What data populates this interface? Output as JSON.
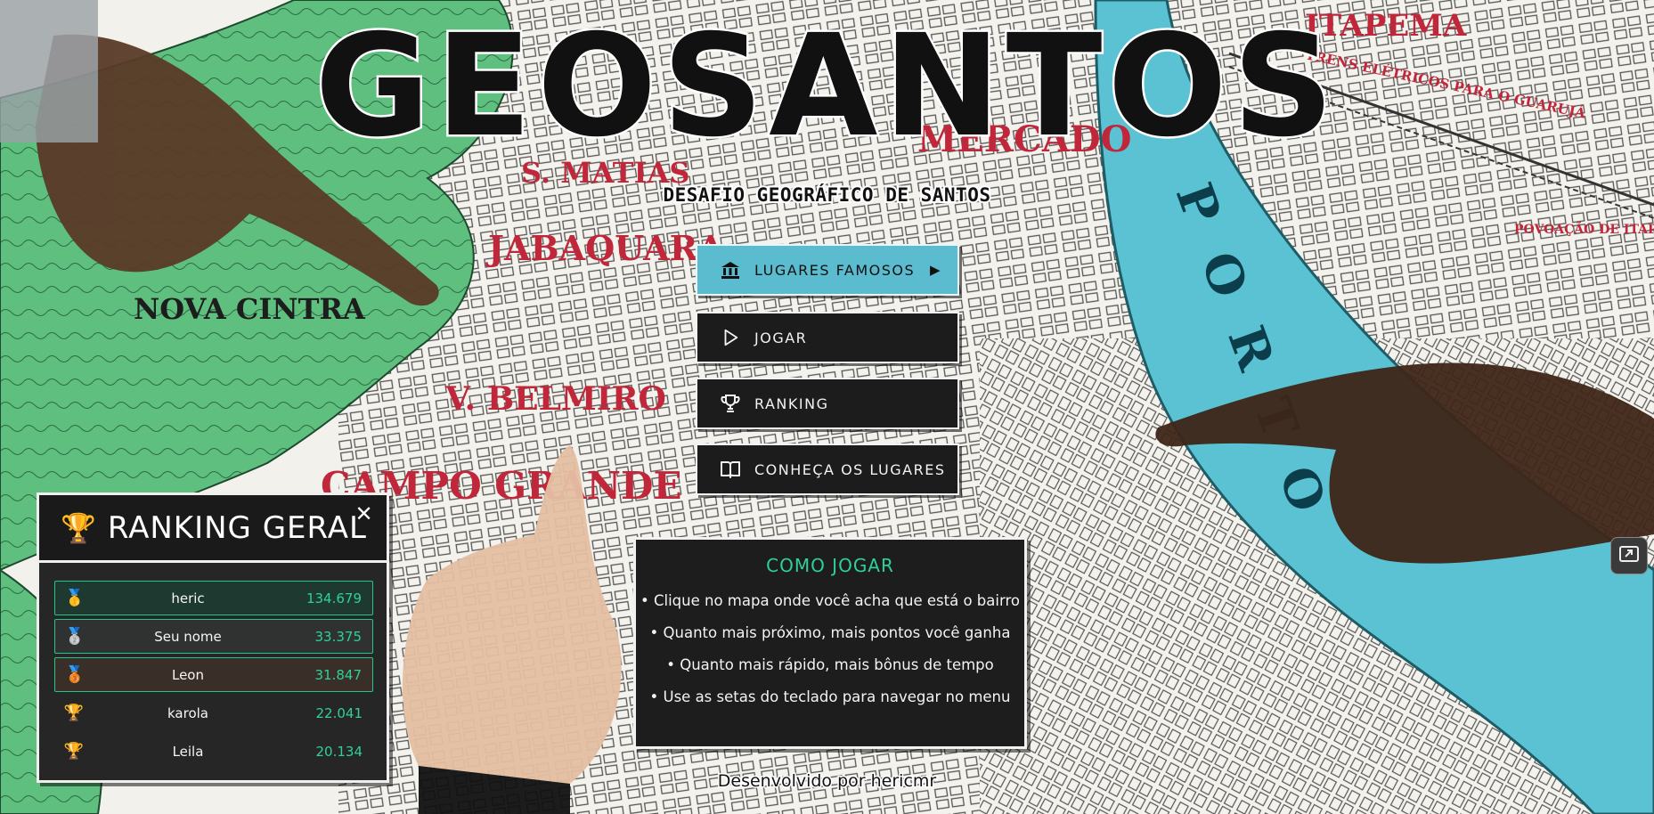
{
  "title": "GEOSANTOS",
  "subtitle": "DESAFIO GEOGRÁFICO DE SANTOS",
  "menu": {
    "items": [
      {
        "label": "LUGARES FAMOSOS",
        "icon": "bank-icon",
        "active": true
      },
      {
        "label": "JOGAR",
        "icon": "play-icon",
        "active": false
      },
      {
        "label": "RANKING",
        "icon": "trophy-icon",
        "active": false
      },
      {
        "label": "CONHEÇA OS LUGARES",
        "icon": "book-icon",
        "active": false
      }
    ],
    "active_arrow": "▶"
  },
  "how_to": {
    "title": "COMO JOGAR",
    "rules": [
      "• Clique no mapa onde você acha que está o bairro",
      "• Quanto mais próximo, mais pontos você ganha",
      "• Quanto mais rápido, mais bônus de tempo",
      "• Use as setas do teclado para navegar no menu"
    ]
  },
  "ranking": {
    "title": "RANKING GERAL",
    "title_icon": "🏆",
    "close_label": "✕",
    "rows": [
      {
        "medal": "🥇",
        "name": "heric",
        "score": "134.679"
      },
      {
        "medal": "🥈",
        "name": "Seu nome",
        "score": "33.375"
      },
      {
        "medal": "🥉",
        "name": "Leon",
        "score": "31.847"
      },
      {
        "medal": "🏆",
        "name": "karola",
        "score": "22.041"
      },
      {
        "medal": "🏆",
        "name": "Leila",
        "score": "20.134"
      }
    ]
  },
  "footer": "Desenvolvido por hericmr",
  "map_labels": {
    "itapema": "ITAPEMA",
    "trens": "TRENS ELÉTRICOS PARA O GUARUJÁ",
    "povoacao": "POVOAÇÃO DE ITAPEMA",
    "mercado": "MERCADO",
    "matias": "S. MATIAS",
    "jabaquara": "JABAQUARA",
    "nova_cintra": "NOVA CINTRA",
    "belmiro": "V. BELMIRO",
    "campo_grande": "CAMPO GRANDE",
    "porto": "PORTO"
  },
  "colors": {
    "accent": "#5bbccf",
    "green_text": "#2ed19b",
    "panel": "#1c1c1c",
    "water": "#5bc2d3",
    "hill": "#5fbf7f"
  }
}
